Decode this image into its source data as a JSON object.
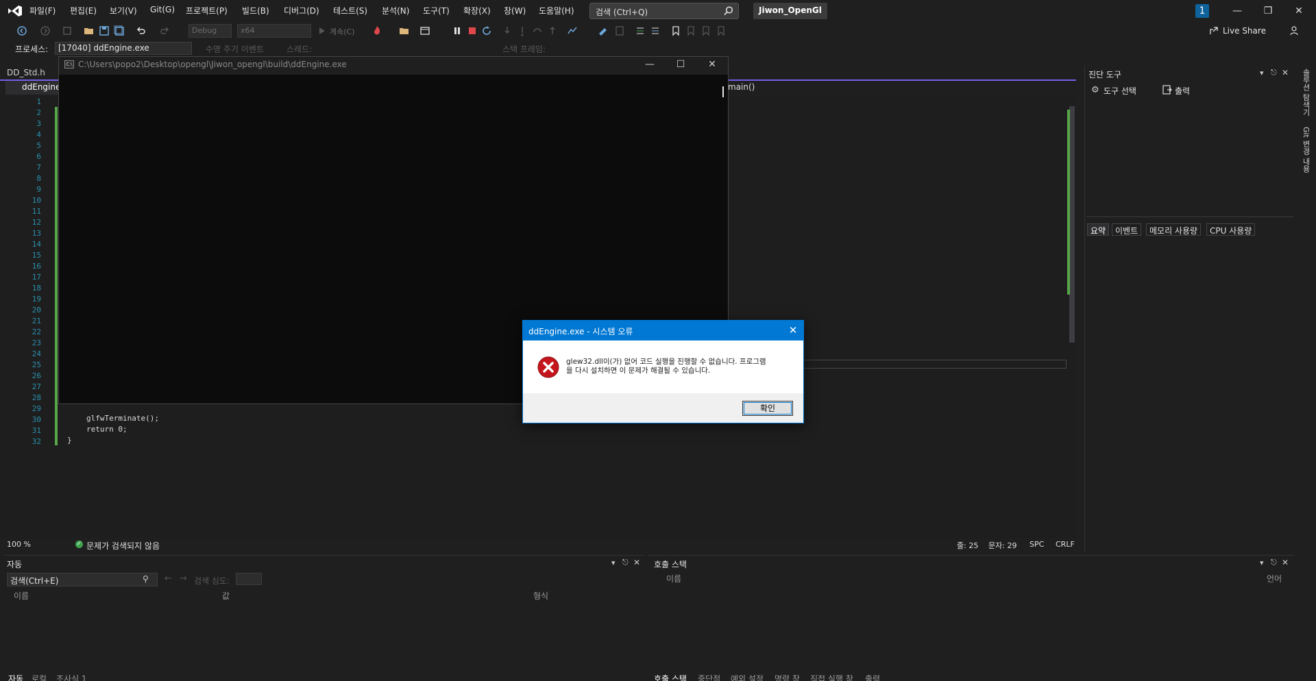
{
  "menu": {
    "items": [
      "파일(F)",
      "편집(E)",
      "보기(V)",
      "Git(G)",
      "프로젝트(P)",
      "빌드(B)",
      "디버그(D)",
      "테스트(S)",
      "분석(N)",
      "도구(T)",
      "확장(X)",
      "창(W)",
      "도움말(H)"
    ],
    "search_placeholder": "검색 (Ctrl+Q)",
    "project_name": "Jiwon_OpenGl",
    "notification_count": "1"
  },
  "toolbar": {
    "config": "Debug",
    "platform": "x64",
    "continue_label": "계속(C)",
    "live_share": "Live Share"
  },
  "debug_location": {
    "process_label": "프로세스:",
    "process_value": "[17040] ddEngine.exe",
    "lifecycle_label": "수명 주기 이벤트",
    "thread_label": "스레드:",
    "stack_frame_label": "스택 프레임:"
  },
  "editor": {
    "tabs": [
      "DD_Std.h",
      "ddEngine"
    ],
    "nav_function": "main()",
    "line_numbers": [
      "1",
      "2",
      "3",
      "4",
      "5",
      "6",
      "7",
      "8",
      "9",
      "10",
      "11",
      "12",
      "13",
      "14",
      "15",
      "16",
      "17",
      "18",
      "19",
      "20",
      "21",
      "22",
      "23",
      "24",
      "25",
      "26",
      "27",
      "28",
      "29",
      "30",
      "31",
      "32"
    ],
    "code_lines": {
      "l30": "glfwTerminate();",
      "l31": "return 0;",
      "l32": "}"
    },
    "status": {
      "zoom": "100 %",
      "issues": "문제가 검색되지 않음",
      "line": "줄: 25",
      "char": "문자: 29",
      "spc": "SPC",
      "crlf": "CRLF"
    }
  },
  "diag_panel": {
    "title": "진단 도구",
    "select_tool": "도구 선택",
    "output": "출력",
    "tabs": [
      "요약",
      "이벤트",
      "메모리 사용량",
      "CPU 사용량"
    ],
    "vertical_tabs": [
      "솔루션 탐색기",
      "Git 변경 내용"
    ]
  },
  "autos_panel": {
    "title": "자동",
    "search": "검색(Ctrl+E)",
    "search_depth": "검색 심도:",
    "columns": [
      "이름",
      "값",
      "형식"
    ],
    "bottom_tabs": [
      "자동",
      "로컬",
      "조사식 1"
    ]
  },
  "callstack_panel": {
    "title": "호출 스택",
    "columns": [
      "이름",
      "언어"
    ],
    "bottom_tabs": [
      "호출 스택",
      "중단점",
      "예외 설정",
      "명령 창",
      "직접 실행 창",
      "출력"
    ]
  },
  "console": {
    "title": "C:\\Users\\popo2\\Desktop\\opengl\\Jiwon_opengl\\build\\ddEngine.exe"
  },
  "dialog": {
    "title": "ddEngine.exe - 시스템 오류",
    "message_line1": "glew32.dll이(가) 없어 코드 실행을 진행할 수 없습니다. 프로그램",
    "message_line2": "을 다시 설치하면 이 문제가 해결될 수 있습니다.",
    "ok": "확인"
  },
  "colors": {
    "accent": "#0078d4",
    "tab_accent": "#7160e8",
    "change_green": "#57a64a",
    "line_number": "#2b91af"
  }
}
